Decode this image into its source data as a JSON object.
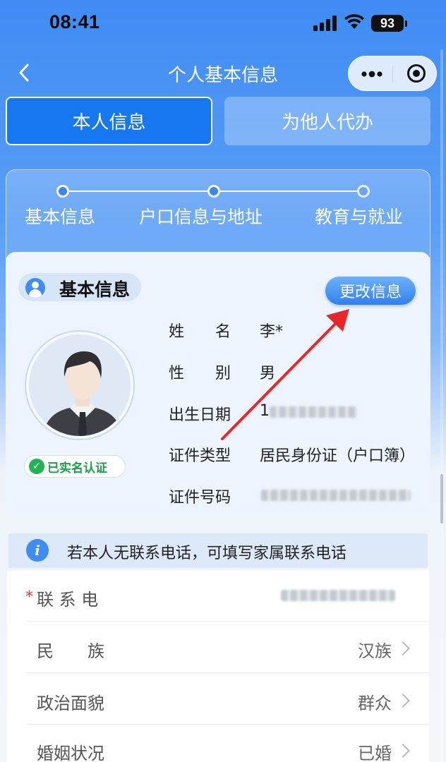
{
  "status_bar": {
    "time": "08:41",
    "battery": "93"
  },
  "nav": {
    "title": "个人基本信息"
  },
  "tabs": [
    {
      "label": "本人信息",
      "active": true
    },
    {
      "label": "为他人代办",
      "active": false
    }
  ],
  "steps": [
    {
      "label": "基本信息",
      "state": "done"
    },
    {
      "label": "户口信息与地址",
      "state": "done"
    },
    {
      "label": "教育与就业",
      "state": "pending"
    }
  ],
  "info_card": {
    "title": "基本信息",
    "edit_label": "更改信息",
    "verified_label": "已实名认证",
    "fields": [
      {
        "label": "姓　　名",
        "value": "李*"
      },
      {
        "label": "性　　别",
        "value": "男"
      },
      {
        "label": "出生日期",
        "value": "1"
      },
      {
        "label": "证件类型",
        "value": "居民身份证（户口簿）"
      },
      {
        "label": "证件号码",
        "value": ""
      }
    ]
  },
  "tip": {
    "text": "若本人无联系电话，可填写家属联系电话"
  },
  "form_rows": [
    {
      "label": "联 系 电",
      "value": "",
      "required": true
    },
    {
      "label": "民　　族",
      "value": "汉族"
    },
    {
      "label": "政治面貌",
      "value": "群众"
    },
    {
      "label": "婚姻状况",
      "value": "已婚"
    }
  ],
  "colors": {
    "primary": "#1677f0",
    "accent": "#3f8cf3",
    "annotation": "#e8272c",
    "verified": "#23b255"
  }
}
